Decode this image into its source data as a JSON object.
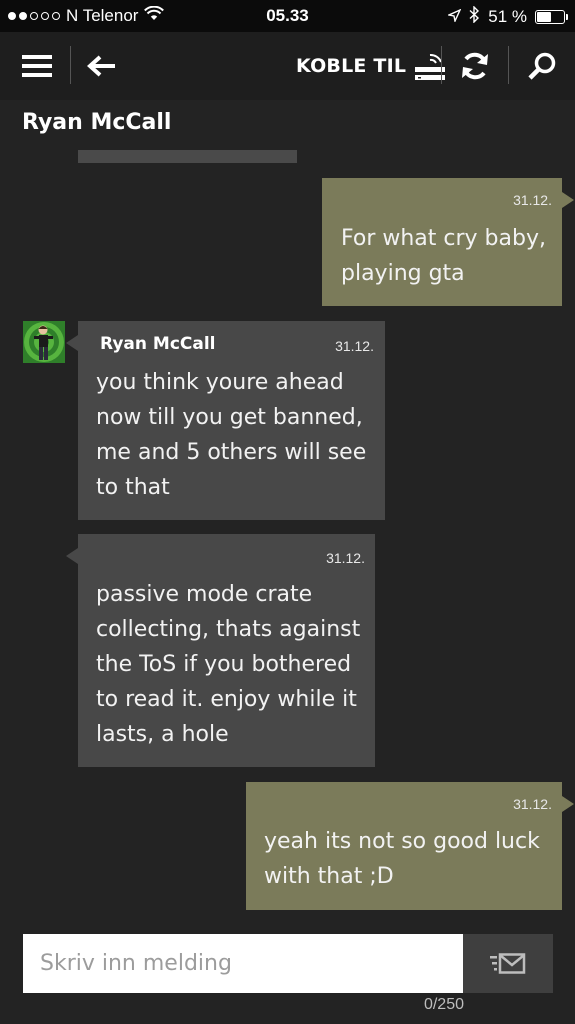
{
  "status_bar": {
    "carrier": "N Telenor",
    "time": "05.33",
    "battery_text": "51 %",
    "battery_level": 0.51,
    "signal_bars_filled": 2,
    "signal_bars_total": 5
  },
  "app_bar": {
    "connect_label": "KOBLE TIL",
    "icons": [
      "menu-icon",
      "back-arrow-icon",
      "router-icon",
      "refresh-icon",
      "search-icon"
    ]
  },
  "conversation": {
    "contact_name": "Ryan McCall",
    "messages": [
      {
        "direction": "outgoing",
        "date": "31.12.",
        "text_lines": [
          "For what cry baby,",
          "playing gta"
        ]
      },
      {
        "direction": "incoming",
        "sender": "Ryan McCall",
        "date": "31.12.",
        "text_lines": [
          "you think youre ahead",
          "now till you get banned,",
          "me and 5 others will see",
          "to that"
        ]
      },
      {
        "direction": "incoming",
        "date": "31.12.",
        "text_lines": [
          "passive mode crate",
          "collecting, thats against",
          "the ToS if you bothered",
          "to read it. enjoy while it",
          "lasts, a hole"
        ]
      },
      {
        "direction": "outgoing",
        "date": "31.12.",
        "text_lines": [
          "yeah its not so good luck",
          "with that ;D"
        ]
      }
    ]
  },
  "composer": {
    "placeholder": "Skriv inn melding",
    "value": "",
    "counter": "0/250"
  },
  "colors": {
    "background": "#232323",
    "outgoing_bubble": "#7b7b5a",
    "incoming_bubble": "#484848",
    "app_bar": "#1e1e1e"
  }
}
